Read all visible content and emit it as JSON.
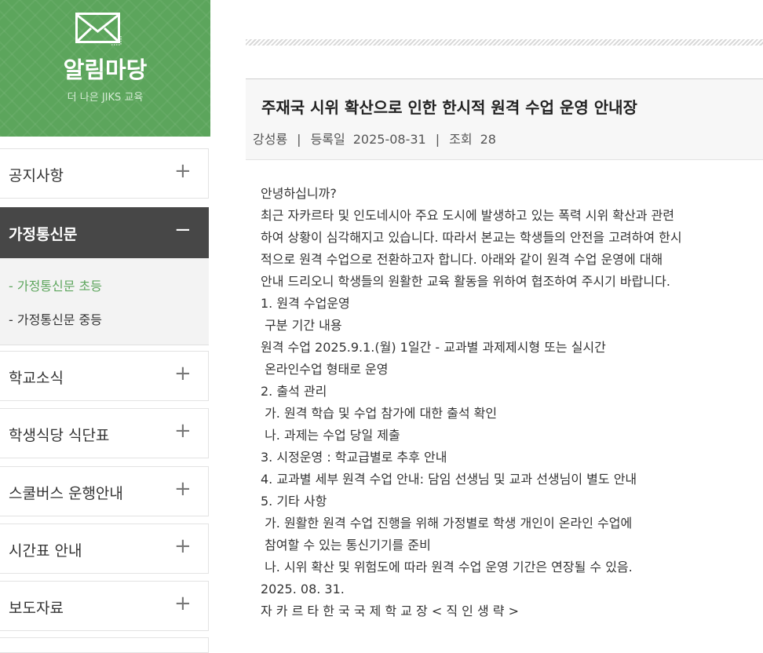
{
  "sidebar": {
    "title": "알림마당",
    "subtitle": "더 나은 JIKS 교육",
    "menu": [
      {
        "label": "공지사항",
        "sign": "+"
      },
      {
        "label": "가정통신문",
        "sign": "−"
      },
      {
        "label": "학교소식",
        "sign": "+"
      },
      {
        "label": "학생식당 식단표",
        "sign": "+"
      },
      {
        "label": "스쿨버스 운행안내",
        "sign": "+"
      },
      {
        "label": "시간표 안내",
        "sign": "+"
      },
      {
        "label": "보도자료",
        "sign": "+"
      }
    ],
    "submenu": [
      "- 가정통신문 초등",
      "- 가정통신문 중등"
    ]
  },
  "post": {
    "title": "주재국 시위 확산으로 인한 한시적 원격 수업 운영 안내장",
    "author": "강성룡",
    "separator": "|",
    "date_label": "등록일",
    "date": "2025-08-31",
    "views_label": "조회",
    "views": "28",
    "body": [
      "안녕하십니까?",
      "최근 자카르타 및 인도네시아 주요 도시에 발생하고 있는 폭력 시위 확산과 관련",
      "하여 상황이 심각해지고 있습니다. 따라서 본교는 학생들의 안전을 고려하여 한시",
      "적으로 원격 수업으로 전환하고자 합니다. 아래와 같이 원격 수업 운영에 대해",
      "안내 드리오니 학생들의 원활한 교육 활동을 위하여 협조하여 주시기 바랍니다.",
      "1. 원격 수업운영",
      " 구분 기간 내용",
      "원격 수업 2025.9.1.(월) 1일간 - 교과별 과제제시형 또는 실시간",
      " 온라인수업 형태로 운영",
      "2. 출석 관리",
      " 가. 원격 학습 및 수업 참가에 대한 출석 확인",
      " 나. 과제는 수업 당일 제출",
      "3. 시정운영 : 학교급별로 추후 안내",
      "4. 교과별 세부 원격 수업 안내: 담임 선생님 및 교과 선생님이 별도 안내",
      "5. 기타 사항",
      " 가. 원활한 원격 수업 진행을 위해 가정별로 학생 개인이 온라인 수업에",
      " 참여할 수 있는 통신기기를 준비",
      " 나. 시위 확산 및 위험도에 따라 원격 수업 운영 기간은 연장될 수 있음.",
      "2025. 08. 31.",
      "자 카 르 타 한 국 국 제 학 교 장 < 직 인 생 략 >"
    ]
  }
}
